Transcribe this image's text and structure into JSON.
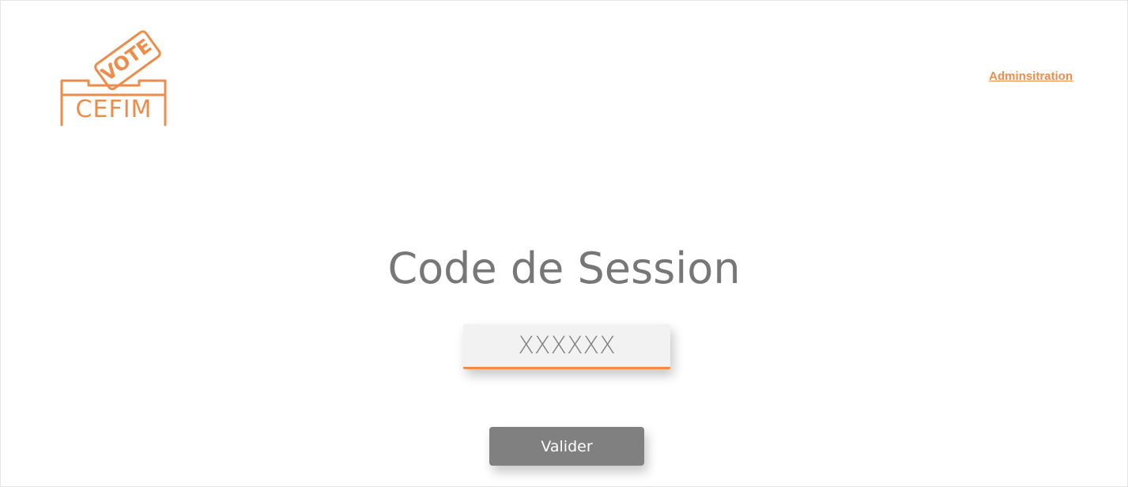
{
  "header": {
    "logo": {
      "badge_text": "VOTE",
      "word": "CEFIM",
      "color": "#EE8C4A"
    },
    "admin_link": "Adminsitration"
  },
  "main": {
    "title": "Code de Session",
    "code_input": {
      "value": "",
      "placeholder": "XXXXXX"
    },
    "submit_label": "Valider"
  },
  "colors": {
    "accent": "#EE8C4A",
    "title_gray": "#777777",
    "button_gray": "#808080",
    "input_bg": "#F2F2F2"
  }
}
